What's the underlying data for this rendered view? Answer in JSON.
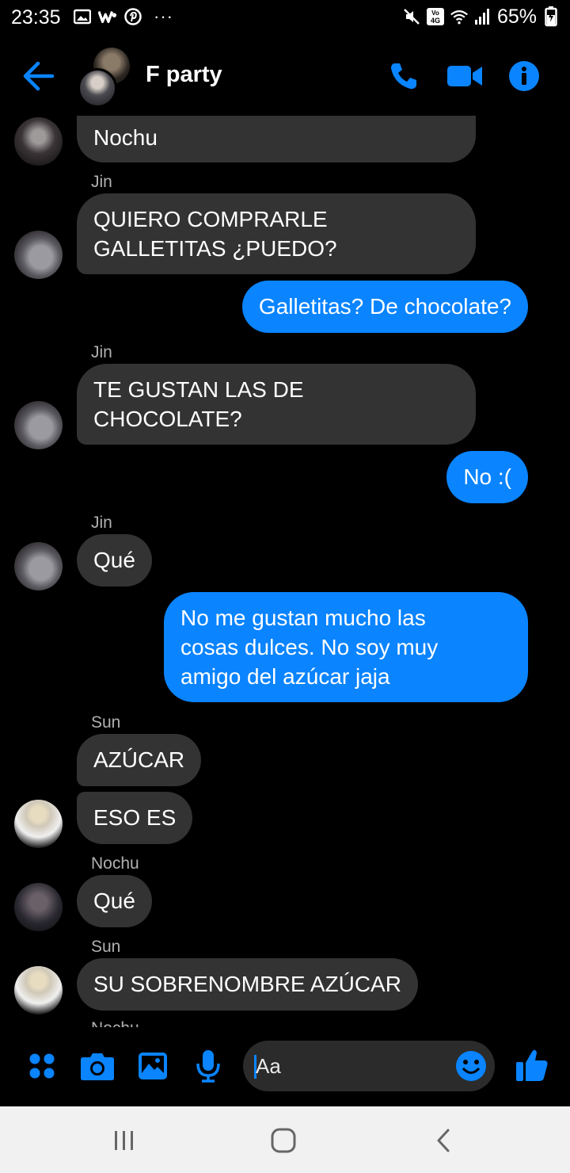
{
  "status_bar": {
    "time": "23:35",
    "battery": "65%",
    "left_icons": [
      "image-icon",
      "w-icon",
      "pinterest-icon"
    ],
    "more": "···",
    "right_icons": [
      "mute-icon",
      "volte-icon",
      "wifi-icon",
      "signal-icon",
      "battery-icon"
    ]
  },
  "header": {
    "title": "F party",
    "icons": [
      "back-arrow-icon",
      "phone-icon",
      "video-icon",
      "info-icon"
    ],
    "accent_color": "#0a84ff"
  },
  "messages": [
    {
      "direction": "in",
      "text": "Nochu"
    },
    {
      "direction": "in",
      "sender": "Jin",
      "text": "QUIERO COMPRARLE\nGALLETITAS ¿PUEDO?"
    },
    {
      "direction": "out",
      "text": "Galletitas? De chocolate?"
    },
    {
      "direction": "in",
      "sender": "Jin",
      "text": "TE GUSTAN LAS DE\nCHOCOLATE?"
    },
    {
      "direction": "out",
      "text": "No :("
    },
    {
      "direction": "in",
      "sender": "Jin",
      "text": "Qué"
    },
    {
      "direction": "out",
      "text": "No me gustan mucho las\ncosas dulces. No soy muy\namigo del azúcar jaja"
    },
    {
      "direction": "in",
      "sender": "Sun",
      "text": "AZÚCAR"
    },
    {
      "direction": "in",
      "text": "ESO ES"
    },
    {
      "direction": "in",
      "sender": "Nochu",
      "text": "Qué"
    },
    {
      "direction": "in",
      "sender": "Sun",
      "text": "SU SOBRENOMBRE AZÚCAR"
    },
    {
      "direction": "in",
      "sender": "Nochu",
      "text": ""
    }
  ],
  "composer": {
    "placeholder": "Aa",
    "icons": [
      "apps-icon",
      "camera-icon",
      "gallery-icon",
      "mic-icon",
      "emoji-icon",
      "like-icon"
    ]
  },
  "nav_bar": {
    "icons": [
      "recents-icon",
      "home-icon",
      "back-icon"
    ]
  },
  "colors": {
    "incoming_bubble": "#333333",
    "outgoing_bubble": "#0a84ff",
    "background": "#000000"
  }
}
